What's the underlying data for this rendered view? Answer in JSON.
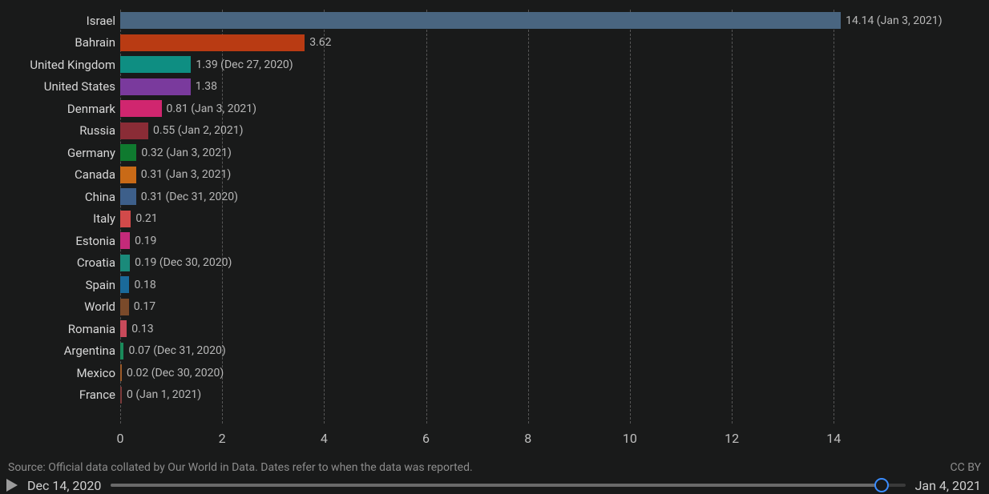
{
  "chart_data": {
    "type": "bar",
    "orientation": "horizontal",
    "xlabel": "",
    "ylabel": "",
    "xlim": [
      0,
      14.2
    ],
    "ticks": [
      0,
      2,
      4,
      6,
      8,
      10,
      12,
      14
    ],
    "series": [
      {
        "name": "Israel",
        "value": 14.14,
        "annotation": "14.14 (Jan 3, 2021)",
        "color": "#496580"
      },
      {
        "name": "Bahrain",
        "value": 3.62,
        "annotation": "3.62",
        "color": "#b93b13"
      },
      {
        "name": "United Kingdom",
        "value": 1.39,
        "annotation": "1.39 (Dec 27, 2020)",
        "color": "#0e8e82"
      },
      {
        "name": "United States",
        "value": 1.38,
        "annotation": "1.38",
        "color": "#7a3a9d"
      },
      {
        "name": "Denmark",
        "value": 0.81,
        "annotation": "0.81 (Jan 3, 2021)",
        "color": "#d0266f"
      },
      {
        "name": "Russia",
        "value": 0.55,
        "annotation": "0.55 (Jan 2, 2021)",
        "color": "#8a2c36"
      },
      {
        "name": "Germany",
        "value": 0.32,
        "annotation": "0.32 (Jan 3, 2021)",
        "color": "#0f7a2f"
      },
      {
        "name": "Canada",
        "value": 0.31,
        "annotation": "0.31 (Jan 3, 2021)",
        "color": "#c96a17"
      },
      {
        "name": "China",
        "value": 0.31,
        "annotation": "0.31 (Dec 31, 2020)",
        "color": "#3d5f8a"
      },
      {
        "name": "Italy",
        "value": 0.21,
        "annotation": "0.21",
        "color": "#d24a4a"
      },
      {
        "name": "Estonia",
        "value": 0.19,
        "annotation": "0.19",
        "color": "#c42a7a"
      },
      {
        "name": "Croatia",
        "value": 0.19,
        "annotation": "0.19 (Dec 30, 2020)",
        "color": "#1a8a7a"
      },
      {
        "name": "Spain",
        "value": 0.18,
        "annotation": "0.18",
        "color": "#1a6a9a"
      },
      {
        "name": "World",
        "value": 0.17,
        "annotation": "0.17",
        "color": "#7a4a2a"
      },
      {
        "name": "Romania",
        "value": 0.13,
        "annotation": "0.13",
        "color": "#c84a5a"
      },
      {
        "name": "Argentina",
        "value": 0.07,
        "annotation": "0.07 (Dec 31, 2020)",
        "color": "#1a8a5a"
      },
      {
        "name": "Mexico",
        "value": 0.02,
        "annotation": "0.02 (Dec 30, 2020)",
        "color": "#9a5a2a"
      },
      {
        "name": "France",
        "value": 0,
        "annotation": "0 (Jan 1, 2021)",
        "color": "#7a3a3a"
      }
    ]
  },
  "source_text": "Source: Official data collated by Our World in Data. Dates refer to when the data was reported.",
  "license": "CC BY",
  "timeline": {
    "start_label": "Dec 14, 2020",
    "end_label": "Jan 4, 2021",
    "position_pct": 97
  }
}
